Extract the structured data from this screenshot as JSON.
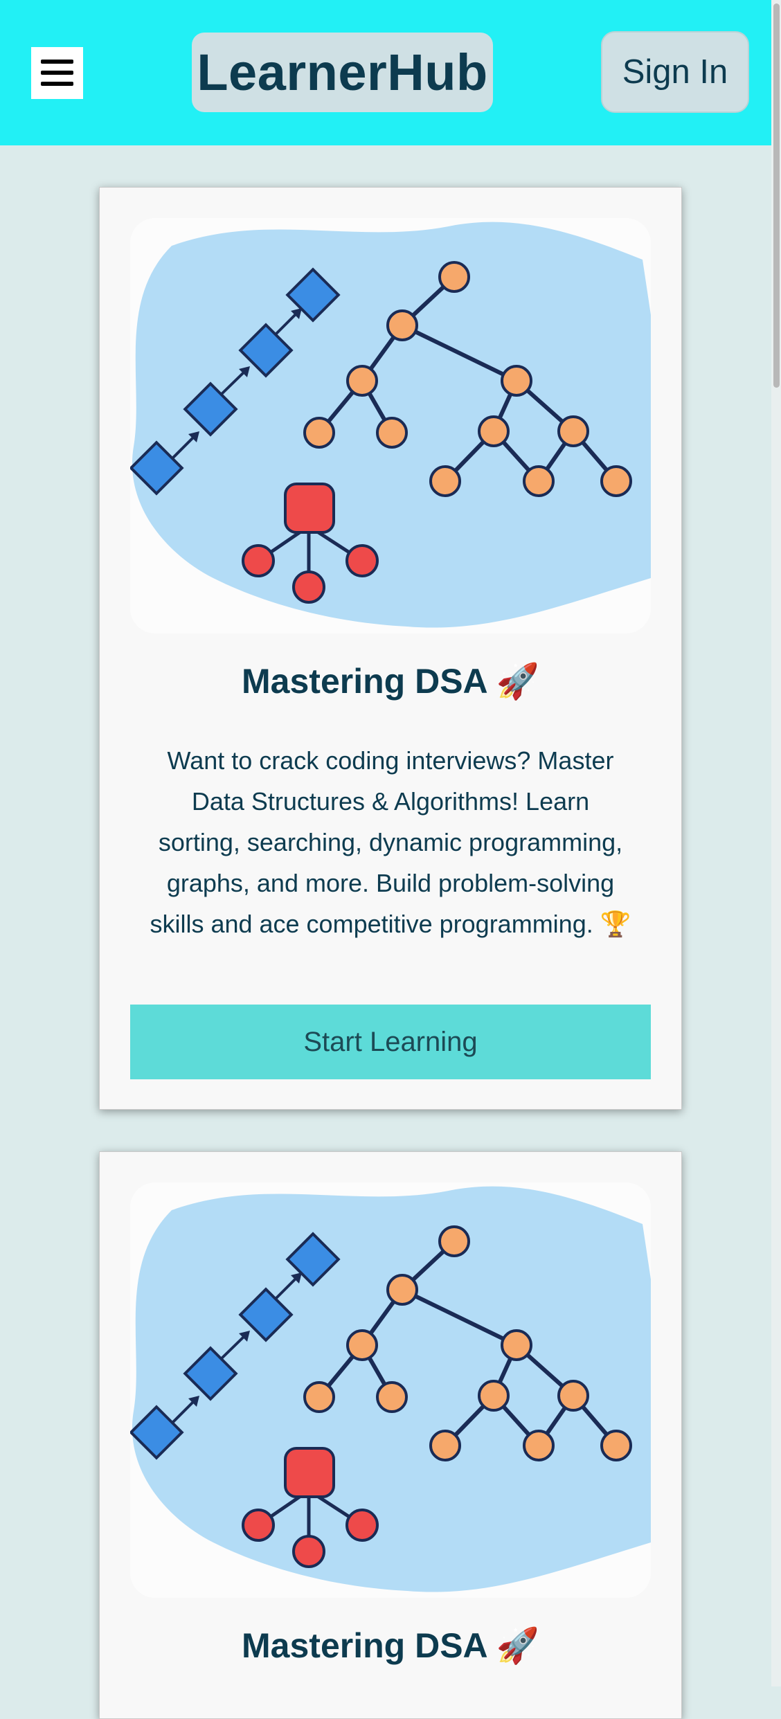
{
  "header": {
    "menu_icon": "hamburger-menu-icon",
    "brand": "LearnerHub",
    "signin_label": "Sign In"
  },
  "cards": [
    {
      "image_icon": "data-structures-illustration",
      "title": "Mastering DSA 🚀",
      "description": "Want to crack coding interviews? Master Data Structures & Algorithms! Learn sorting, searching, dynamic programming, graphs, and more. Build problem-solving skills and ace competitive programming. 🏆",
      "cta_label": "Start Learning"
    },
    {
      "image_icon": "data-structures-illustration",
      "title": "Mastering DSA 🚀"
    }
  ],
  "colors": {
    "header_bg": "#22f0f5",
    "page_bg": "#dcebeb",
    "cta_bg": "#5ddbd8",
    "text": "#0d3b4f"
  }
}
